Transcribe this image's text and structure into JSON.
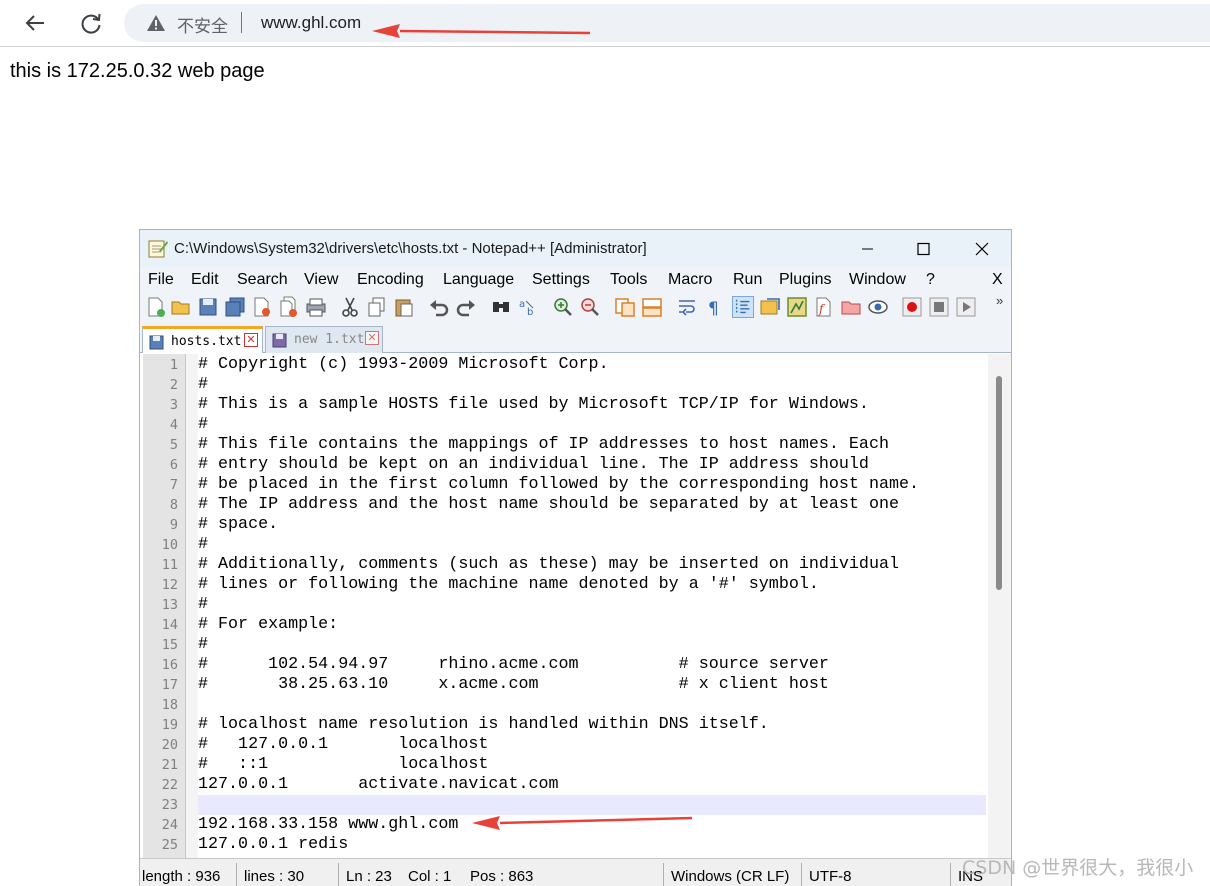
{
  "browser": {
    "security_label": "不安全",
    "url": "www.ghl.com",
    "page_text": "this is 172.25.0.32 web page"
  },
  "annotation_color": "#e8413a",
  "notepad": {
    "title": "C:\\Windows\\System32\\drivers\\etc\\hosts.txt - Notepad++ [Administrator]",
    "menu": [
      "File",
      "Edit",
      "Search",
      "View",
      "Encoding",
      "Language",
      "Settings",
      "Tools",
      "Macro",
      "Run",
      "Plugins",
      "Window",
      "?"
    ],
    "menu_close": "X",
    "toolbar_more": "»",
    "tabs": [
      {
        "label": "hosts.txt",
        "active": true
      },
      {
        "label": "new 1.txt",
        "active": false
      }
    ],
    "current_line": 23,
    "lines": [
      "# Copyright (c) 1993-2009 Microsoft Corp.",
      "#",
      "# This is a sample HOSTS file used by Microsoft TCP/IP for Windows.",
      "#",
      "# This file contains the mappings of IP addresses to host names. Each",
      "# entry should be kept on an individual line. The IP address should",
      "# be placed in the first column followed by the corresponding host name.",
      "# The IP address and the host name should be separated by at least one",
      "# space.",
      "#",
      "# Additionally, comments (such as these) may be inserted on individual",
      "# lines or following the machine name denoted by a '#' symbol.",
      "#",
      "# For example:",
      "#",
      "#      102.54.94.97     rhino.acme.com          # source server",
      "#       38.25.63.10     x.acme.com              # x client host",
      "",
      "# localhost name resolution is handled within DNS itself.",
      "#   127.0.0.1       localhost",
      "#   ::1             localhost",
      "127.0.0.1       activate.navicat.com",
      "",
      "192.168.33.158 www.ghl.com",
      "127.0.0.1 redis"
    ],
    "status": {
      "length": "length : 936",
      "lines": "lines : 30",
      "ln": "Ln : 23",
      "col": "Col : 1",
      "pos": "Pos : 863",
      "eol": "Windows (CR LF)",
      "encoding": "UTF-8",
      "mode": "INS"
    }
  },
  "watermark": "CSDN @世界很大，我很小"
}
